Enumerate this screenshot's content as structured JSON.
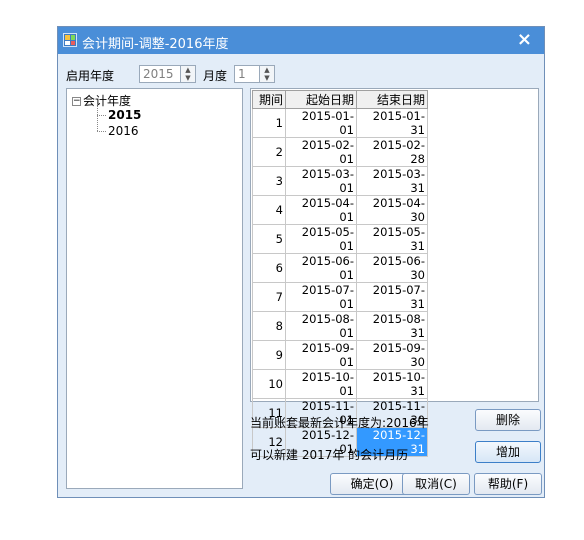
{
  "window": {
    "title": "会计期间-调整-2016年度",
    "close_glyph": "×"
  },
  "form": {
    "start_year_label": "启用年度",
    "start_year_value": "2015",
    "month_label": "月度",
    "month_value": "1"
  },
  "tree": {
    "root_label": "会计年度",
    "expand_glyph": "−",
    "children": [
      "2015",
      "2016"
    ]
  },
  "calendar": {
    "headers": [
      "期间",
      "起始日期",
      "结束日期"
    ],
    "rows": [
      [
        "1",
        "2015-01-01",
        "2015-01-31"
      ],
      [
        "2",
        "2015-02-01",
        "2015-02-28"
      ],
      [
        "3",
        "2015-03-01",
        "2015-03-31"
      ],
      [
        "4",
        "2015-04-01",
        "2015-04-30"
      ],
      [
        "5",
        "2015-05-01",
        "2015-05-31"
      ],
      [
        "6",
        "2015-06-01",
        "2015-06-30"
      ],
      [
        "7",
        "2015-07-01",
        "2015-07-31"
      ],
      [
        "8",
        "2015-08-01",
        "2015-08-31"
      ],
      [
        "9",
        "2015-09-01",
        "2015-09-30"
      ],
      [
        "10",
        "2015-10-01",
        "2015-10-31"
      ],
      [
        "11",
        "2015-11-01",
        "2015-11-30"
      ],
      [
        "12",
        "2015-12-01",
        "2015-12-31"
      ]
    ]
  },
  "status": {
    "latest_year_text": "当前账套最新会计年度为:2016年",
    "new_calendar_text": "可以新建  2017年 的会计月历"
  },
  "buttons": {
    "delete": "删除",
    "add": "增加",
    "ok": "确定(O)",
    "cancel": "取消(C)",
    "help": "帮助(F)"
  },
  "colors": {
    "titlebar": "#4a8ed8",
    "dialog_bg": "#e3edf8",
    "selection": "#3399ff"
  }
}
